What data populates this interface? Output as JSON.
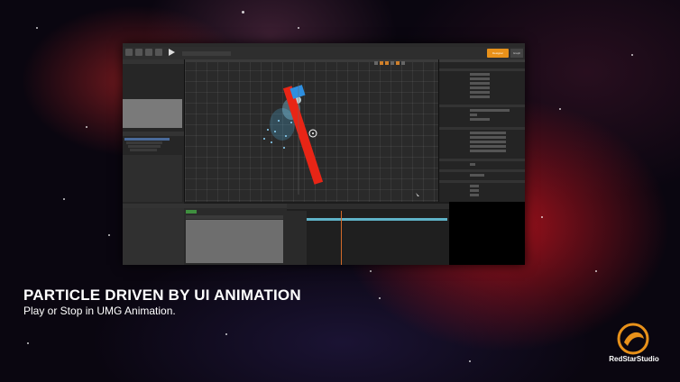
{
  "caption": {
    "title": "PARTICLE DRIVEN BY UI ANIMATION",
    "subtitle": "Play or Stop in UMG Animation."
  },
  "editor": {
    "designer_label": "Designer",
    "graph_label": "Graph",
    "widget_name_field": "",
    "accent_color": "#e8911a",
    "bar_color": "#e82516",
    "button_color": "#2e8fe0",
    "particle_color": "#4fb6e8",
    "track_color": "#5fb3c8"
  },
  "logo": {
    "text": "RedStarStudio",
    "icon": "redstar-logo-icon"
  }
}
